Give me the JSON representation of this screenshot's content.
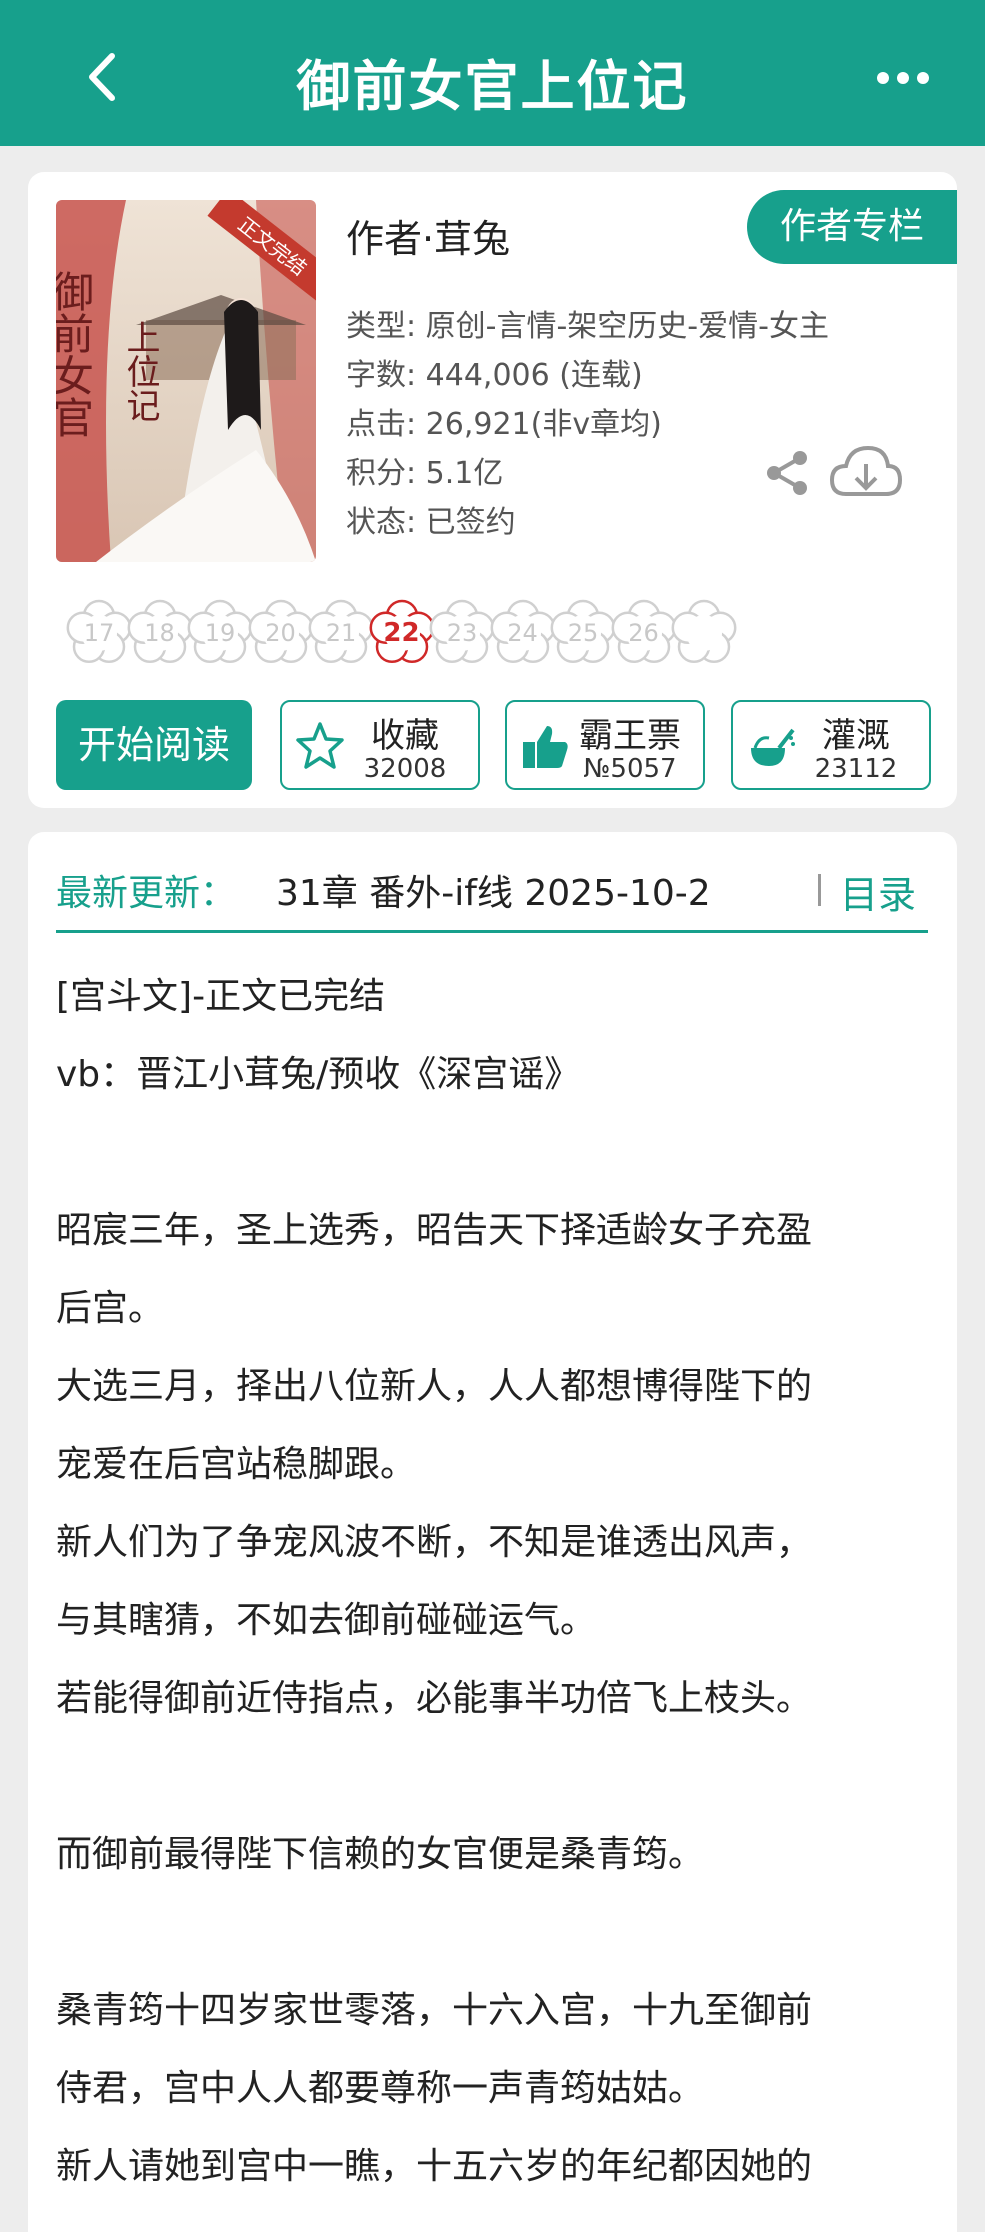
{
  "header": {
    "title": "御前女官上位记"
  },
  "book": {
    "author": "作者·茸兔",
    "author_column_label": "作者专栏",
    "cover": {
      "badge": "正文完结",
      "calligraphy_left": "御前女官",
      "calligraphy_right": "上位记",
      "colors": {
        "sky": "#e8d8c8",
        "curtain": "#c8554f",
        "dress": "#f3f0ec",
        "hair": "#1e1a1a"
      }
    },
    "meta": [
      "类型: 原创-言情-架空历史-爱情-女主",
      "字数: 444,006 (连载)",
      "点击: 26,921(非v章均)",
      "积分: 5.1亿",
      "状态: 已签约"
    ],
    "flowers": [
      "17",
      "18",
      "19",
      "20",
      "21",
      "22",
      "23",
      "24",
      "25",
      "26"
    ],
    "active_flower": "22"
  },
  "actions": {
    "start_reading": "开始阅读",
    "favorite": {
      "label": "收藏",
      "count": "32008"
    },
    "ticket": {
      "label": "霸王票",
      "count": "№5057"
    },
    "water": {
      "label": "灌溉",
      "count": "23112"
    }
  },
  "latest": {
    "label": "最新更新：",
    "info": "31章  番外-if线  2025-10-2",
    "toc_label": "目录"
  },
  "description": [
    "[宫斗文]-正文已完结",
    "vb：晋江小茸兔/预收《深宫谣》",
    "",
    "昭宸三年，圣上选秀，昭告天下择适龄女子充盈",
    "后宫。",
    "大选三月，择出八位新人，人人都想博得陛下的",
    "宠爱在后宫站稳脚跟。",
    "新人们为了争宠风波不断，不知是谁透出风声，",
    "与其瞎猜，不如去御前碰碰运气。",
    "若能得御前近侍指点，必能事半功倍飞上枝头。",
    "",
    "而御前最得陛下信赖的女官便是桑青筠。",
    "",
    "桑青筠十四岁家世零落，十六入宫，十九至御前",
    "侍君，宫中人人都要尊称一声青筠姑姑。",
    "新人请她到宫中一瞧，十五六岁的年纪都因她的"
  ],
  "colors": {
    "brand": "#17a08c",
    "active_flower": "#d02828"
  }
}
